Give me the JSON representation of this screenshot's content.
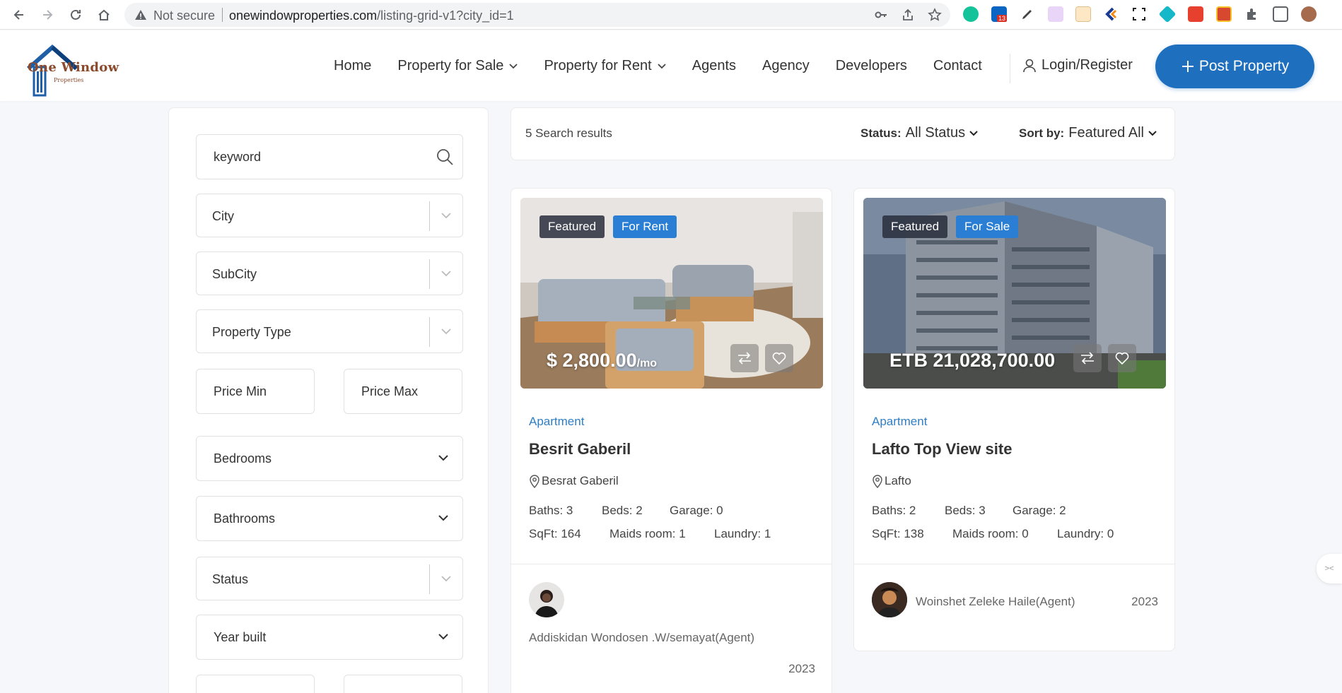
{
  "browser": {
    "security_label": "Not secure",
    "url_host": "onewindowproperties.com",
    "url_path": "/listing-grid-v1?city_id=1",
    "extension_badge": "13"
  },
  "site": {
    "logo_text": "One Window",
    "logo_sub": "Properties",
    "nav": {
      "home": "Home",
      "sale": "Property for Sale",
      "rent": "Property for Rent",
      "agents": "Agents",
      "agency": "Agency",
      "developers": "Developers",
      "contact": "Contact"
    },
    "login_label": "Login/Register",
    "post_label": "Post Property",
    "brand_color": "#1f6fbf"
  },
  "filters": {
    "keyword_placeholder": "keyword",
    "city": "City",
    "subcity": "SubCity",
    "property_type": "Property Type",
    "price_min": "Price Min",
    "price_max": "Price Max",
    "bedrooms": "Bedrooms",
    "bathrooms": "Bathrooms",
    "status": "Status",
    "year_built": "Year built"
  },
  "results": {
    "count_text": "5 Search results",
    "status_label": "Status:",
    "status_value": "All Status",
    "sort_label": "Sort by:",
    "sort_value": "Featured All"
  },
  "listings": [
    {
      "badge_featured": "Featured",
      "badge_type": "For Rent",
      "price": "$ 2,800.00",
      "price_unit": "/mo",
      "category": "Apartment",
      "title": "Besrit Gaberil",
      "location": "Besrat Gaberil",
      "baths": "Baths: 3",
      "beds": "Beds: 2",
      "garage": "Garage: 0",
      "sqft": "SqFt: 164",
      "maids": "Maids room: 1",
      "laundry": "Laundry: 1",
      "agent": "Addiskidan Wondosen .W/semayat(Agent)",
      "year": "2023"
    },
    {
      "badge_featured": "Featured",
      "badge_type": "For Sale",
      "price": "ETB 21,028,700.00",
      "category": "Apartment",
      "title": "Lafto Top View site",
      "location": "Lafto",
      "baths": "Baths: 2",
      "beds": "Beds: 3",
      "garage": "Garage: 2",
      "sqft": "SqFt: 138",
      "maids": "Maids room: 0",
      "laundry": "Laundry: 0",
      "agent": "Woinshet Zeleke Haile(Agent)",
      "year": "2023"
    }
  ]
}
